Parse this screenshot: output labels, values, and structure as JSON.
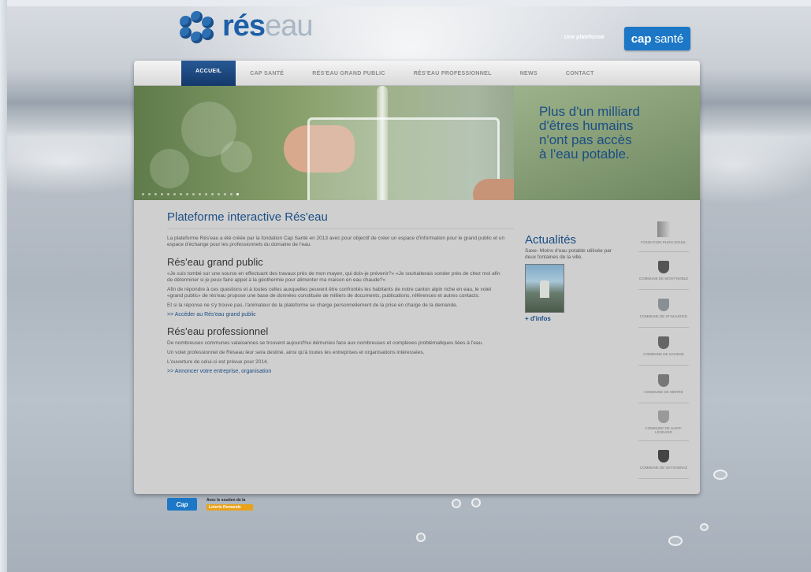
{
  "header": {
    "logo_text_main": "rés",
    "logo_text_soft": "eau",
    "tagline": "Une plateforme",
    "partner_badge": {
      "bold": "cap",
      "normal": "santé"
    }
  },
  "nav": {
    "items": [
      {
        "label": "ACCUEIL",
        "active": true
      },
      {
        "label": "CAP SANTÉ",
        "active": false
      },
      {
        "label": "RÉS'EAU GRAND PUBLIC",
        "active": false
      },
      {
        "label": "RÉS'EAU PROFESSIONNEL",
        "active": false
      },
      {
        "label": "NEWS",
        "active": false
      },
      {
        "label": "CONTACT",
        "active": false
      }
    ]
  },
  "hero": {
    "line1": "Plus d'un milliard",
    "line2": "d'êtres humains",
    "line3": "n'ont pas accès",
    "line4": "à l'eau potable."
  },
  "main": {
    "title": "Plateforme interactive Rés'eau",
    "intro": "La plateforme Rés'eau a été créée par la fondation Cap Santé en 2013 avec pour objectif de créer un espace d'information pour le grand public et un espace d'échange pour les professionnels du domaine de l'eau.",
    "public": {
      "heading": "Rés'eau grand public",
      "p1": "«Je suis tombé sur une source en effectuant des travaux près de mon mayen, qui dois-je prévenir?» «Je souhaiterais sonder près de chez moi afin de déterminer si je peux faire appel à la géothermie pour alimenter ma maison en eau chaude?»",
      "p2": "Afin de répondre à ces questions et à toutes celles auxquelles peuvent être confrontés les habitants de notre canton alpin riche en eau, le volet «grand public» de rés'eau propose une base de données constituée de milliers de documents, publications, références et autres contacts.",
      "p3": "Et si la réponse ne s'y trouve pas, l'animateur de la plateforme se charge personnellement de la prise en charge de la demande.",
      "link": ">> Accéder au Rés'eau grand public"
    },
    "pro": {
      "heading": "Rés'eau professionnel",
      "p1": "De nombreuses communes valaisannes se trouvent aujourd'hui démunies face aux nombreuses et complexes problématiques liées à l'eau.",
      "p2": "Un volet professionnel de Réseau leur sera destiné, ainsi qu'à toutes les entreprises et organisations intéressées.",
      "p3": "L'ouverture de celui-ci est prévue pour 2014.",
      "link": ">> Annoncer votre entreprise, organisation"
    }
  },
  "news": {
    "heading": "Actualités",
    "text": "Saxe- Moins d'eau potable utilisée par deux fontaines de la ville.",
    "more": "+ d'infos"
  },
  "communes": [
    "FONDATION PLEIN SOLEIL ",
    "COMMUNE DE MONT-NOBLE",
    "COMMUNE DE ST-MAURICE",
    "COMMUNE DE SAVIESE",
    "COMMUNE DE SIERRE",
    "COMMUNE DE SAINT-LÉONARD",
    "COMMUNE DE VEYSONNAZ"
  ],
  "footer": {
    "cap_logo": "Cap",
    "support_line1": "Avec le soutien de la",
    "support_badge": "Loterie Romande"
  }
}
